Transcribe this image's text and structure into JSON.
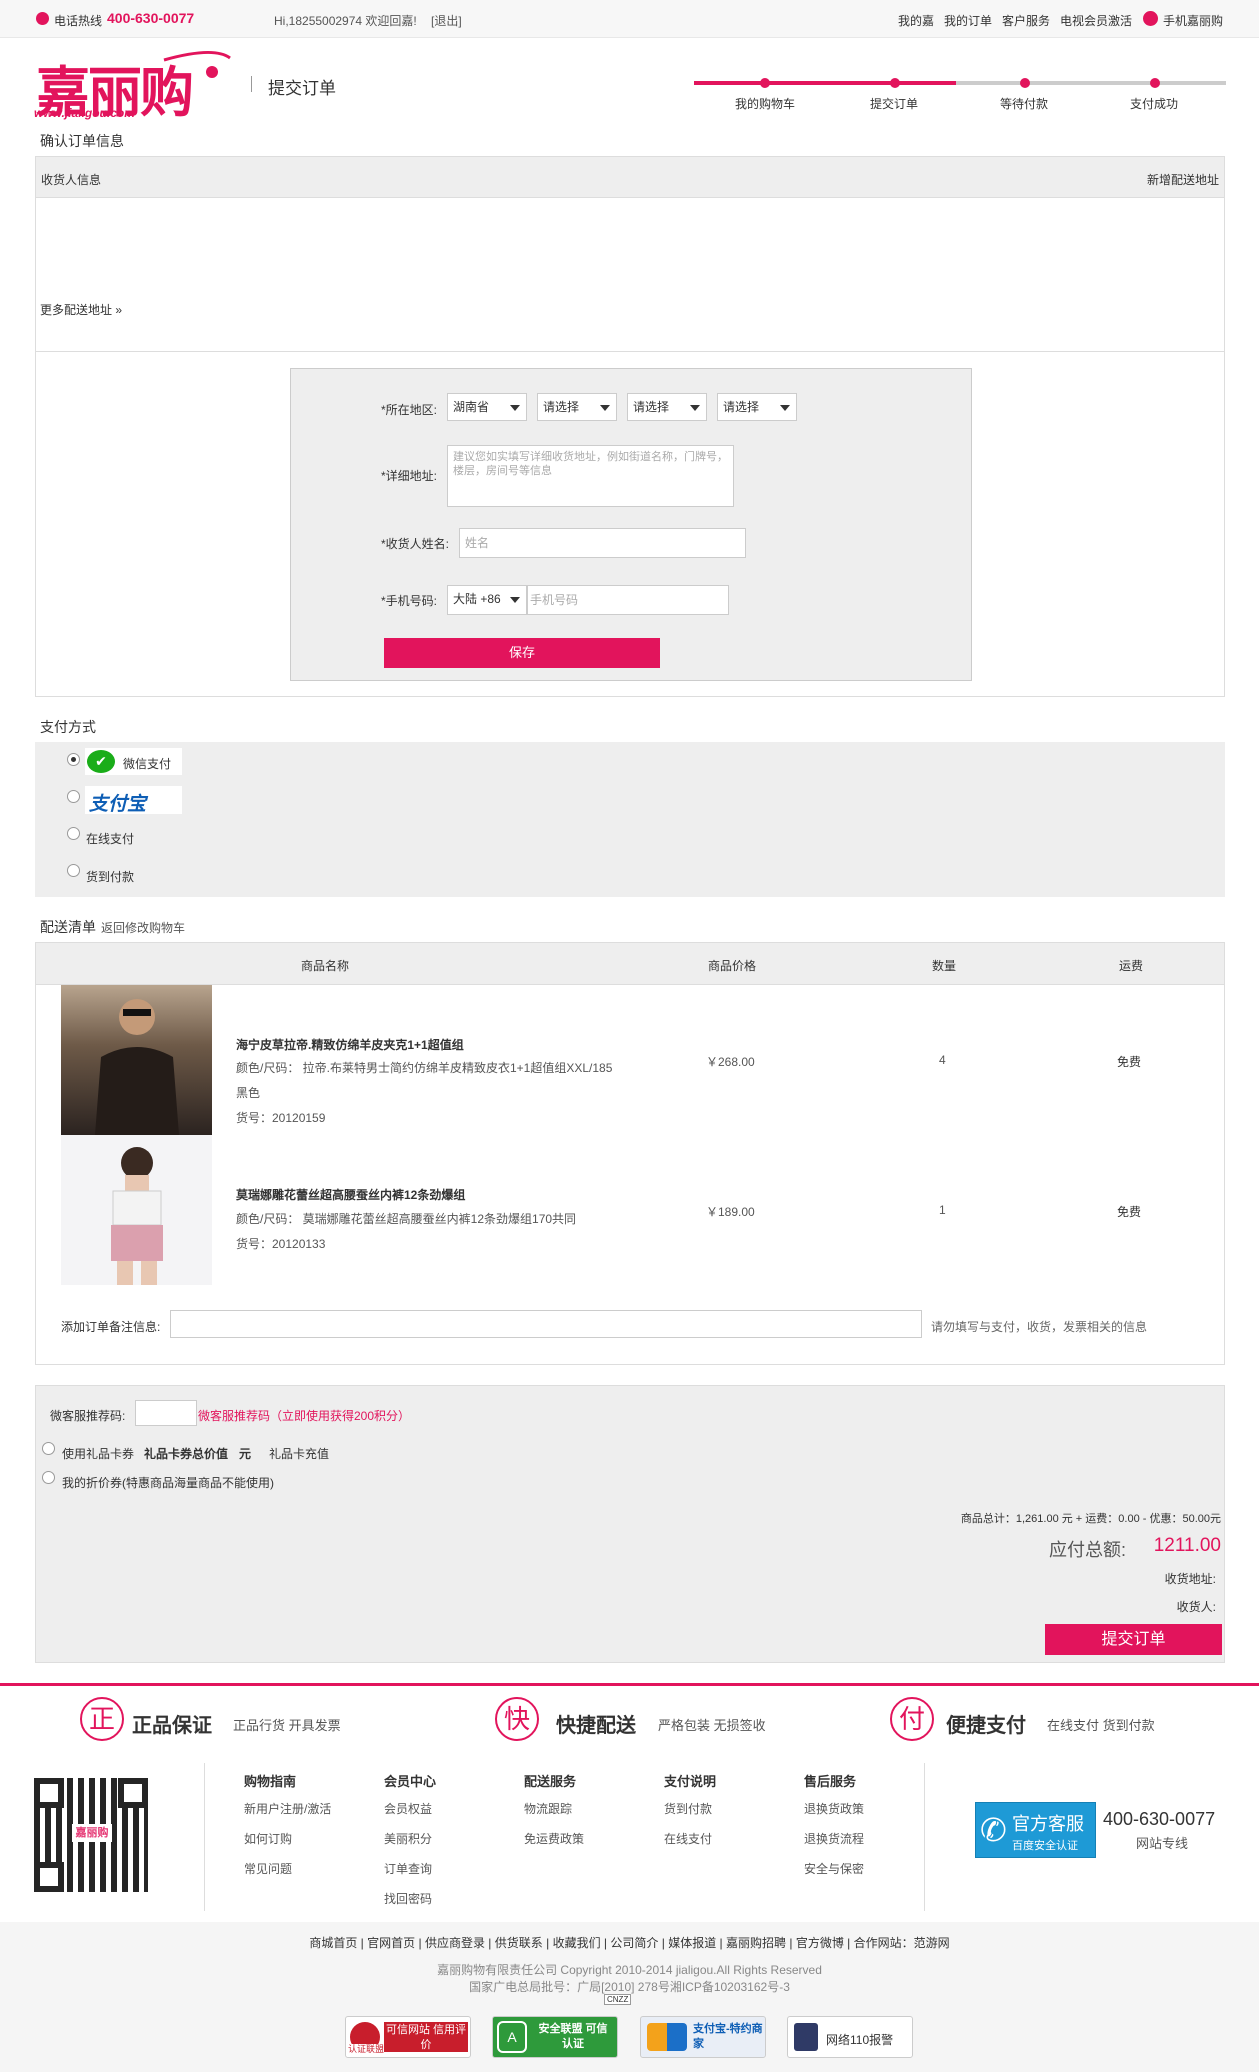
{
  "topbar": {
    "hotline_label": "电话热线",
    "hotline": "400-630-0077",
    "greeting": "Hi,18255002974 欢迎回嘉!",
    "logout": "[退出]",
    "links": [
      "我的嘉",
      "我的订单",
      "客户服务",
      "电视会员激活"
    ],
    "mobile": "手机嘉丽购"
  },
  "logo": {
    "brand": "嘉丽购",
    "url": "www.jialigou.com"
  },
  "page_title": "提交订单",
  "steps": [
    "我的购物车",
    "提交订单",
    "等待付款",
    "支付成功"
  ],
  "confirm_title": "确认订单信息",
  "receiver": {
    "header": "收货人信息",
    "add_new": "新增配送地址",
    "more": "更多配送地址 »"
  },
  "addr_form": {
    "region_label": "*所在地区:",
    "province": "湖南省",
    "city": "请选择",
    "district": "请选择",
    "street": "请选择",
    "detail_label": "*详细地址:",
    "detail_placeholder": "建议您如实填写详细收货地址，例如街道名称，门牌号，楼层，房间号等信息",
    "name_label": "*收货人姓名:",
    "name_placeholder": "姓名",
    "phone_label": "*手机号码:",
    "country_code": "大陆 +86",
    "phone_placeholder": "手机号码",
    "save": "保存"
  },
  "payment": {
    "title": "支付方式",
    "wechat": "微信支付",
    "alipay": "支付宝",
    "online": "在线支付",
    "cod": "货到付款"
  },
  "delivery": {
    "title": "配送清单",
    "back": "返回修改购物车",
    "headers": [
      "商品名称",
      "商品价格",
      "数量",
      "运费"
    ],
    "items": [
      {
        "name": "海宁皮草拉帝.精致仿绵羊皮夹克1+1超值组",
        "spec1": "颜色/尺码： 拉帝.布莱特男士简约仿绵羊皮精致皮衣1+1超值组XXL/185",
        "spec2": "黑色",
        "sku": "货号：20120159",
        "price": "￥268.00",
        "qty": "4",
        "ship": "免费"
      },
      {
        "name": "莫瑞娜雕花蕾丝超高腰蚕丝内裤12条劲爆组",
        "spec1": "颜色/尺码： 莫瑞娜雕花蕾丝超高腰蚕丝内裤12条劲爆组170共同",
        "spec2": "",
        "sku": "货号：20120133",
        "price": "￥189.00",
        "qty": "1",
        "ship": "免费"
      }
    ],
    "note_label": "添加订单备注信息:",
    "note_hint": "请勿填写与支付，收货，发票相关的信息"
  },
  "summary": {
    "referrer_label": "微客服推荐码:",
    "referrer_hint": "微客服推荐码（立即使用获得200积分）",
    "giftcard": "使用礼品卡券",
    "giftcard_total": "礼品卡券总价值",
    "giftcard_unit": "元",
    "giftcard_topup": "礼品卡充值",
    "coupon": "我的折价券(特惠商品海量商品不能使用)",
    "totals": "商品总计：1,261.00 元 + 运费：0.00 - 优惠：50.00元",
    "payable_label": "应付总额:",
    "payable": "1211.00",
    "addr_label": "收货地址:",
    "recv_label": "收货人:",
    "submit": "提交订单"
  },
  "guarantees": [
    {
      "icon": "正",
      "title": "正品保证",
      "desc": "正品行货 开具发票"
    },
    {
      "icon": "快",
      "title": "快捷配送",
      "desc": "严格包装 无损签收"
    },
    {
      "icon": "付",
      "title": "便捷支付",
      "desc": "在线支付 货到付款"
    }
  ],
  "footer_cols": [
    {
      "title": "购物指南",
      "links": [
        "新用户注册/激活",
        "如何订购",
        "常见问题"
      ]
    },
    {
      "title": "会员中心",
      "links": [
        "会员权益",
        "美丽积分",
        "订单查询",
        "找回密码"
      ]
    },
    {
      "title": "配送服务",
      "links": [
        "物流跟踪",
        "免运费政策"
      ]
    },
    {
      "title": "支付说明",
      "links": [
        "货到付款",
        "在线支付"
      ]
    },
    {
      "title": "售后服务",
      "links": [
        "退换货政策",
        "退换货流程",
        "安全与保密"
      ]
    }
  ],
  "service": {
    "title": "官方客服",
    "sub": "百度安全认证",
    "phone": "400-630-0077",
    "label": "网站专线"
  },
  "bottom_links": [
    "商城首页",
    "官网首页",
    "供应商登录",
    "供货联系",
    "收藏我们",
    "公司简介",
    "媒体报道",
    "嘉丽购招聘",
    "官方微博",
    "合作网站：范游网"
  ],
  "copyright": "嘉丽购物有限责任公司 Copyright 2010-2014 jialigou.All Rights Reserved",
  "license": "国家广电总局批号：广局[2010] 278号湘ICP备10203162号-3",
  "cnzz": "CNZZ",
  "badges": [
    "可信网站 信用评价",
    "安全联盟 可信认证",
    "支付宝-特约商家",
    "网络110报警"
  ],
  "badge_sub": "认证联盟",
  "colors": {
    "accent": "#e2145c",
    "bg_gray": "#eeeeee",
    "wechat": "#1aad19"
  }
}
